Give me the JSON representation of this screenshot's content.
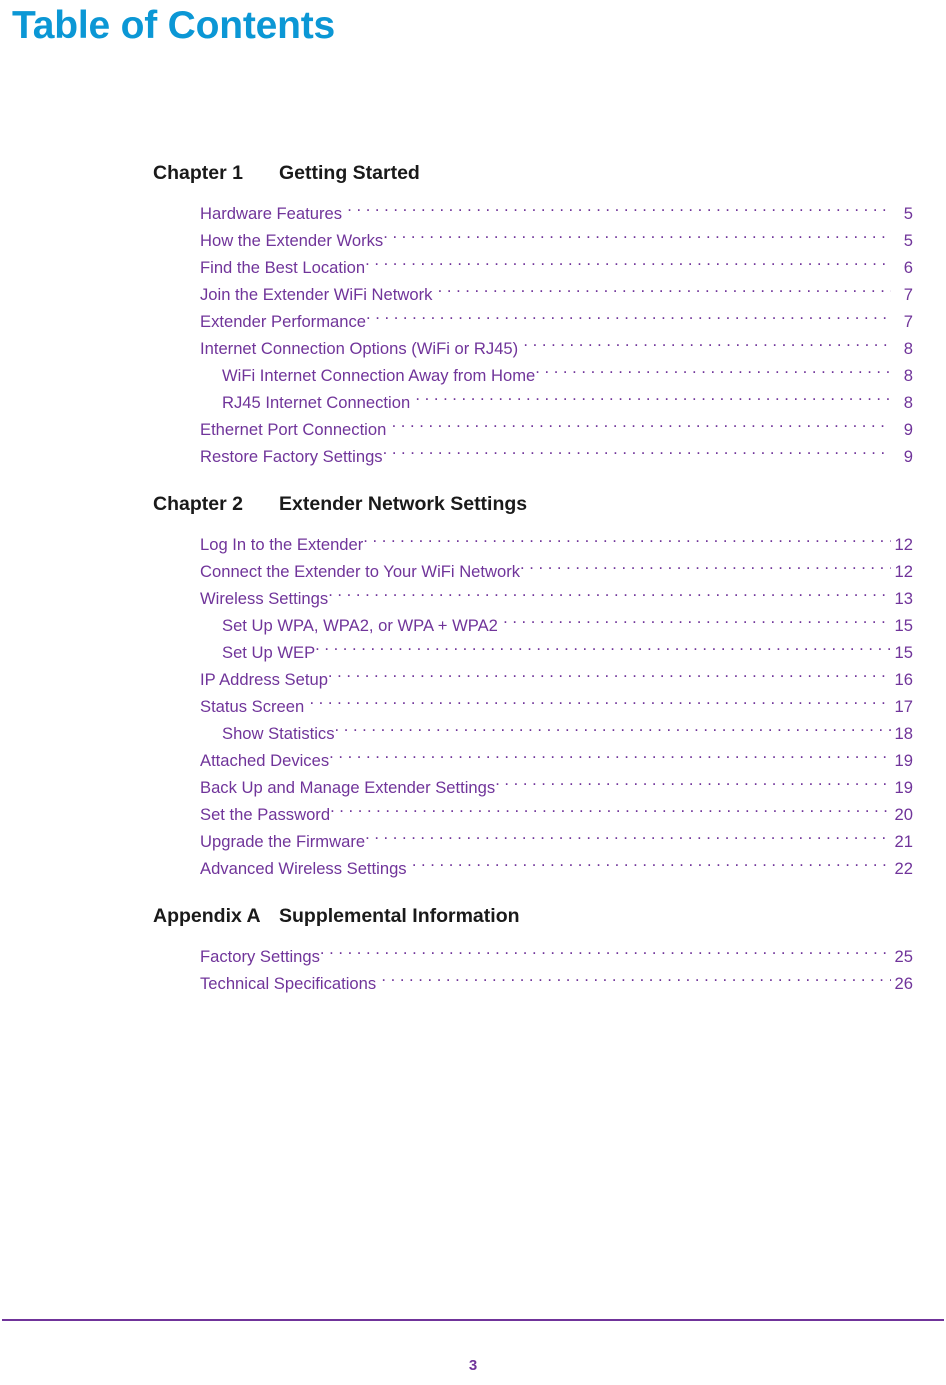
{
  "page": {
    "title": "Table of Contents",
    "footer_page_number": "3",
    "accent_blue": "#0b97d5",
    "accent_purple": "#70349a"
  },
  "sections": [
    {
      "number": "Chapter 1",
      "title": "Getting Started",
      "entries": [
        {
          "title": "Hardware Features",
          "page": "5",
          "level": 1,
          "tight": true
        },
        {
          "title": "How the Extender Works",
          "page": "5",
          "level": 1,
          "tight": false
        },
        {
          "title": "Find the Best Location",
          "page": "6",
          "level": 1,
          "tight": false
        },
        {
          "title": "Join the Extender WiFi Network",
          "page": "7",
          "level": 1,
          "tight": true
        },
        {
          "title": "Extender Performance",
          "page": "7",
          "level": 1,
          "tight": false
        },
        {
          "title": "Internet Connection Options (WiFi or RJ45)",
          "page": "8",
          "level": 1,
          "tight": true
        },
        {
          "title": "WiFi Internet Connection Away from Home",
          "page": "8",
          "level": 2,
          "tight": false
        },
        {
          "title": "RJ45 Internet Connection",
          "page": "8",
          "level": 2,
          "tight": true
        },
        {
          "title": "Ethernet Port Connection",
          "page": "9",
          "level": 1,
          "tight": true
        },
        {
          "title": "Restore Factory Settings",
          "page": "9",
          "level": 1,
          "tight": false
        }
      ]
    },
    {
      "number": "Chapter 2",
      "title": "Extender Network Settings",
      "entries": [
        {
          "title": "Log In to the Extender",
          "page": "12",
          "level": 1,
          "tight": false
        },
        {
          "title": "Connect the Extender to Your WiFi Network",
          "page": "12",
          "level": 1,
          "tight": false
        },
        {
          "title": "Wireless Settings",
          "page": "13",
          "level": 1,
          "tight": false
        },
        {
          "title": "Set Up WPA, WPA2, or WPA + WPA2",
          "page": "15",
          "level": 2,
          "tight": true
        },
        {
          "title": "Set Up WEP",
          "page": "15",
          "level": 2,
          "tight": false
        },
        {
          "title": "IP Address Setup",
          "page": "16",
          "level": 1,
          "tight": false
        },
        {
          "title": "Status Screen",
          "page": "17",
          "level": 1,
          "tight": true
        },
        {
          "title": "Show Statistics",
          "page": "18",
          "level": 2,
          "tight": false
        },
        {
          "title": "Attached Devices",
          "page": "19",
          "level": 1,
          "tight": false
        },
        {
          "title": "Back Up and Manage Extender Settings",
          "page": "19",
          "level": 1,
          "tight": false
        },
        {
          "title": "Set the Password",
          "page": "20",
          "level": 1,
          "tight": false
        },
        {
          "title": "Upgrade the Firmware",
          "page": "21",
          "level": 1,
          "tight": false
        },
        {
          "title": "Advanced Wireless Settings",
          "page": "22",
          "level": 1,
          "tight": true
        }
      ]
    },
    {
      "number": "Appendix A",
      "title": "Supplemental Information",
      "entries": [
        {
          "title": "Factory Settings",
          "page": "25",
          "level": 1,
          "tight": false
        },
        {
          "title": "Technical Specifications",
          "page": "26",
          "level": 1,
          "tight": true
        }
      ]
    }
  ]
}
